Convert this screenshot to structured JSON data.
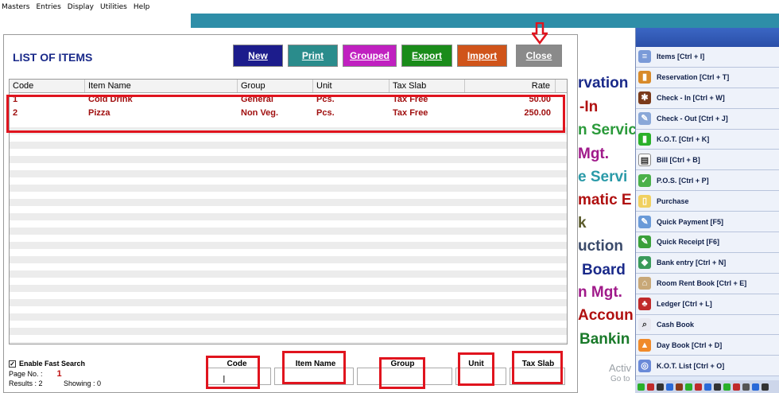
{
  "menubar": [
    "Masters",
    "Entries",
    "Display",
    "Utilities",
    "Help"
  ],
  "dialog": {
    "title": "LIST OF ITEMS",
    "buttons": {
      "new": "New",
      "print": "Print",
      "grouped": "Grouped",
      "export": "Export",
      "import": "Import",
      "close": "Close"
    },
    "columns": [
      "Code",
      "Item Name",
      "Group",
      "Unit",
      "Tax Slab",
      "Rate"
    ],
    "rows": [
      [
        "1",
        "Cold Drink",
        "General",
        "Pcs.",
        "Tax Free",
        "50.00"
      ],
      [
        "2",
        "Pizza",
        "Non Veg.",
        "Pcs.",
        "Tax Free",
        "250.00"
      ]
    ],
    "footer": {
      "fast_search_label": "Enable Fast Search",
      "fast_search_checked": "✓",
      "page_no_label": "Page No. :",
      "page_no": "1",
      "results_label": "Results : 2",
      "showing_label": "Showing :  0",
      "search_fields": [
        "Code",
        "Item Name",
        "Group",
        "Unit",
        "Tax Slab"
      ]
    }
  },
  "background_menu": [
    "rvation",
    "-In",
    "n Servic",
    "Mgt.",
    "e Servi",
    "matic E",
    "k",
    "uction",
    "Board",
    "n Mgt.",
    "Accoun",
    "Bankin"
  ],
  "sidebar": [
    "Items [Ctrl + I]",
    "Reservation [Ctrl + T]",
    "Check - In [Ctrl + W]",
    "Check - Out [Ctrl + J]",
    "K.O.T. [Ctrl + K]",
    "Bill [Ctrl + B]",
    "P.O.S. [Ctrl + P]",
    "Purchase",
    "Quick Payment [F5]",
    "Quick Receipt [F6]",
    "Bank entry [Ctrl + N]",
    "Room Rent Book [Ctrl + E]",
    "Ledger [Ctrl + L]",
    "Cash Book",
    "Day Book [Ctrl + D]",
    "K.O.T. List [Ctrl + O]"
  ],
  "watermark": [
    "Activ",
    "Go to"
  ],
  "colors": {
    "title": "#1a2a8a",
    "new": "#1c1c8c",
    "print": "#2a8c8c",
    "grouped": "#c020c0",
    "export": "#1a8c1a",
    "import": "#d0541a",
    "close": "#8a8a8a",
    "highlight": "#e0141e",
    "row_text": "#a01010"
  }
}
